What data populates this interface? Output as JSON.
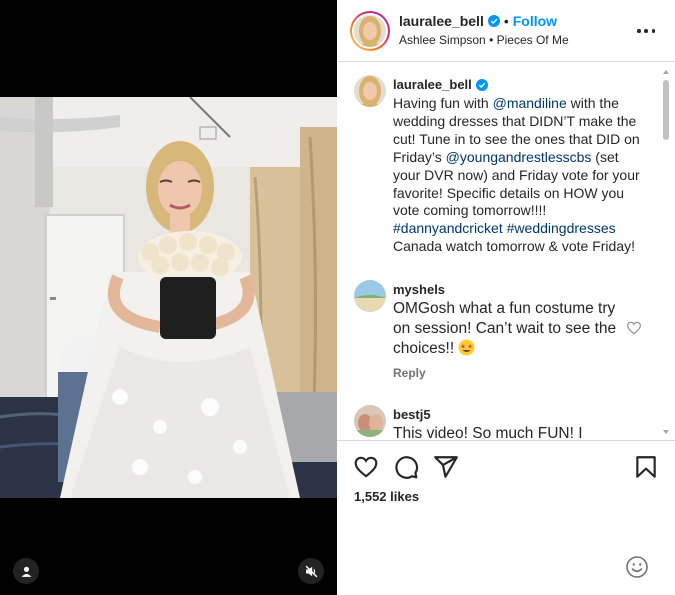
{
  "post": {
    "username": "lauralee_bell",
    "separator": "•",
    "follow_label": "Follow",
    "audio": {
      "artist": "Ashlee Simpson",
      "separator": "•",
      "track": "Pieces Of Me"
    },
    "caption": {
      "username": "lauralee_bell",
      "t1": "Having fun with ",
      "m1": "@mandiline",
      "t2": " with the wedding dresses that DIDN’T make the cut! Tune in to see the ones that DID on Friday’s ",
      "m2": "@youngandrestlesscbs",
      "t3": " (set your DVR now) and Friday vote for your favorite! Specific details on HOW you vote coming tomorrow!!!! ",
      "m3": "#dannyandcricket",
      "t4": " ",
      "m4": "#weddingdresses",
      "t5": " Canada watch tomorrow & vote Friday!"
    },
    "comments": [
      {
        "username": "myshels",
        "text": "OMGosh what a fun costume try on session! Can’t wait to see the choices!! ",
        "emoji": "star-struck-emoji",
        "reply_label": "Reply"
      },
      {
        "username": "bestj5",
        "text": "This video! So much FUN! I"
      }
    ],
    "likes": "1,552 likes"
  },
  "colors": {
    "link": "#00376b",
    "follow": "#0095f6",
    "verified": "#0095f6",
    "secondary_text": "#737373",
    "border": "#dbdbdb"
  },
  "icons": {
    "media": [
      "user-tag-icon",
      "muted-speaker-icon"
    ],
    "actions": [
      "heart-icon",
      "comment-icon",
      "share-icon",
      "bookmark-icon"
    ],
    "composer": "emoji-icon"
  }
}
